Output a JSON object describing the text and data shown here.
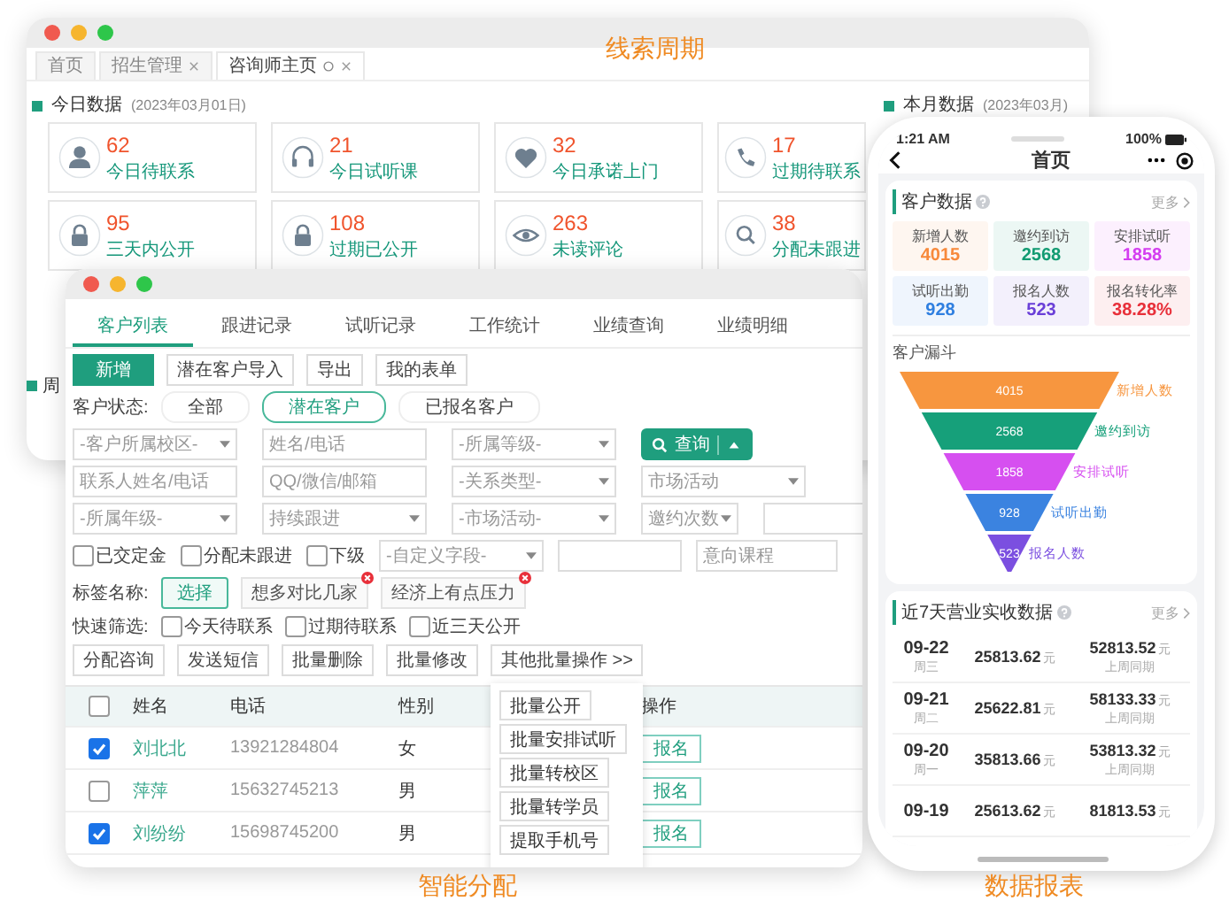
{
  "back_window": {
    "caption": "线索周期",
    "tabs": [
      {
        "label": "首页",
        "selected": false,
        "closable": false
      },
      {
        "label": "招生管理",
        "selected": false,
        "closable": true
      },
      {
        "label": "咨询师主页",
        "selected": true,
        "closable": true
      }
    ],
    "today_section": {
      "title": "今日数据",
      "date": "(2023年03月01日)"
    },
    "month_section": {
      "title": "本月数据",
      "date": "(2023年03月)"
    },
    "week_section": {
      "title": "周"
    },
    "stat_cards": [
      {
        "kind": "person",
        "value": "62",
        "label": "今日待联系"
      },
      {
        "kind": "headphones",
        "value": "21",
        "label": "今日试听课"
      },
      {
        "kind": "heart",
        "value": "32",
        "label": "今日承诺上门"
      },
      {
        "kind": "phone",
        "value": "17",
        "label": "过期待联系"
      },
      {
        "kind": "lock",
        "value": "95",
        "label": "三天内公开"
      },
      {
        "kind": "lock",
        "value": "108",
        "label": "过期已公开"
      },
      {
        "kind": "eye",
        "value": "263",
        "label": "未读评论"
      },
      {
        "kind": "search",
        "value": "38",
        "label": "分配未跟进"
      }
    ]
  },
  "front_window": {
    "caption": "智能分配",
    "tabs": [
      {
        "label": "客户列表",
        "selected": true
      },
      {
        "label": "跟进记录",
        "selected": false
      },
      {
        "label": "试听记录",
        "selected": false
      },
      {
        "label": "工作统计",
        "selected": false
      },
      {
        "label": "业绩查询",
        "selected": false
      },
      {
        "label": "业绩明细",
        "selected": false
      }
    ],
    "action_buttons": [
      {
        "label": "新增",
        "kind": "primary"
      },
      {
        "label": "潜在客户导入",
        "kind": "default"
      },
      {
        "label": "导出",
        "kind": "default"
      },
      {
        "label": "我的表单",
        "kind": "default"
      }
    ],
    "status_filter": {
      "label": "客户状态:",
      "options": [
        {
          "label": "全部",
          "selected": false
        },
        {
          "label": "潜在客户",
          "selected": true
        },
        {
          "label": "已报名客户",
          "selected": false
        }
      ]
    },
    "filter_rows": [
      [
        {
          "kind": "select",
          "placeholder": "-客户所属校区-"
        },
        {
          "kind": "input",
          "placeholder": "姓名/电话"
        },
        {
          "kind": "select",
          "placeholder": "-所属等级-"
        },
        {
          "kind": "search_button",
          "label": "查询"
        }
      ],
      [
        {
          "kind": "input",
          "placeholder": "联系人姓名/电话"
        },
        {
          "kind": "input",
          "placeholder": "QQ/微信/邮箱"
        },
        {
          "kind": "select",
          "placeholder": "-关系类型-"
        },
        {
          "kind": "select",
          "placeholder": "市场活动"
        }
      ],
      [
        {
          "kind": "select",
          "placeholder": "-所属年级-"
        },
        {
          "kind": "select",
          "placeholder": "持续跟进"
        },
        {
          "kind": "select",
          "placeholder": "-市场活动-"
        },
        {
          "kind": "select_small",
          "placeholder": "邀约次数"
        },
        {
          "kind": "input"
        }
      ],
      [
        {
          "kind": "checkbox",
          "label": "已交定金",
          "checked": false
        },
        {
          "kind": "checkbox",
          "label": "分配未跟进",
          "checked": false
        },
        {
          "kind": "checkbox",
          "label": "下级",
          "checked": false
        },
        {
          "kind": "select",
          "placeholder": "-自定义字段-"
        },
        {
          "kind": "input"
        },
        {
          "kind": "input",
          "placeholder": "意向课程"
        }
      ]
    ],
    "tags": {
      "label": "标签名称:",
      "choose": "选择",
      "items": [
        "想多对比几家",
        "经济上有点压力"
      ]
    },
    "quick_filter": {
      "label": "快速筛选:",
      "options": [
        {
          "label": "今天待联系",
          "checked": false
        },
        {
          "label": "过期待联系",
          "checked": false
        },
        {
          "label": "近三天公开",
          "checked": false
        }
      ]
    },
    "batch_buttons": [
      "分配咨询",
      "发送短信",
      "批量删除",
      "批量修改",
      "其他批量操作 >>"
    ],
    "batch_menu": [
      "批量公开",
      "批量安排试听",
      "批量转校区",
      "批量转学员",
      "提取手机号"
    ],
    "table": {
      "select_all_checked": false,
      "columns": [
        "姓名",
        "电话",
        "性别",
        "操作"
      ],
      "rows": [
        {
          "checked": true,
          "name": "刘北北",
          "phone": "13921284804",
          "gender": "女",
          "action": "报名"
        },
        {
          "checked": false,
          "name": "萍萍",
          "phone": "15632745213",
          "gender": "男",
          "action": "报名"
        },
        {
          "checked": true,
          "name": "刘纷纷",
          "phone": "15698745200",
          "gender": "男",
          "action": "报名"
        }
      ]
    }
  },
  "phone": {
    "caption": "数据报表",
    "time": "1:21 AM",
    "battery": "100%",
    "title": "首页",
    "customer_card": {
      "title": "客户数据",
      "more": "更多",
      "tiles": [
        {
          "label": "新增人数",
          "value": "4015",
          "color": "#f7893b"
        },
        {
          "label": "邀约到访",
          "value": "2568",
          "color": "#129b72"
        },
        {
          "label": "安排试听",
          "value": "1858",
          "color": "#d43ef0"
        },
        {
          "label": "试听出勤",
          "value": "928",
          "color": "#2f7fe0"
        },
        {
          "label": "报名人数",
          "value": "523",
          "color": "#6a3fd8"
        },
        {
          "label": "报名转化率",
          "value": "38.28%",
          "color": "#e8303a"
        }
      ]
    },
    "funnel_title": "客户漏斗",
    "funnel": [
      {
        "value": "4015",
        "label": "新增人数",
        "color": "#f7963f"
      },
      {
        "value": "2568",
        "label": "邀约到访",
        "color": "#16a07a"
      },
      {
        "value": "1858",
        "label": "安排试听",
        "color": "#d64ff0"
      },
      {
        "value": "928",
        "label": "试听出勤",
        "color": "#3b83e0"
      },
      {
        "value": "523",
        "label": "报名人数",
        "color": "#7b4fe0"
      }
    ],
    "sales_card": {
      "title": "近7天营业实收数据",
      "more": "更多",
      "rows": [
        {
          "date": "09-22",
          "weekday": "周三",
          "amount": "25813.62",
          "amount_unit": "元",
          "compare": "52813.52",
          "compare_unit": "元",
          "compare_label": "上周同期"
        },
        {
          "date": "09-21",
          "weekday": "周二",
          "amount": "25622.81",
          "amount_unit": "元",
          "compare": "58133.33",
          "compare_unit": "元",
          "compare_label": "上周同期"
        },
        {
          "date": "09-20",
          "weekday": "周一",
          "amount": "35813.66",
          "amount_unit": "元",
          "compare": "53813.32",
          "compare_unit": "元",
          "compare_label": "上周同期"
        },
        {
          "date": "09-19",
          "amount": "25613.62",
          "amount_unit": "元",
          "compare": "81813.53",
          "compare_unit": "元"
        }
      ]
    }
  }
}
